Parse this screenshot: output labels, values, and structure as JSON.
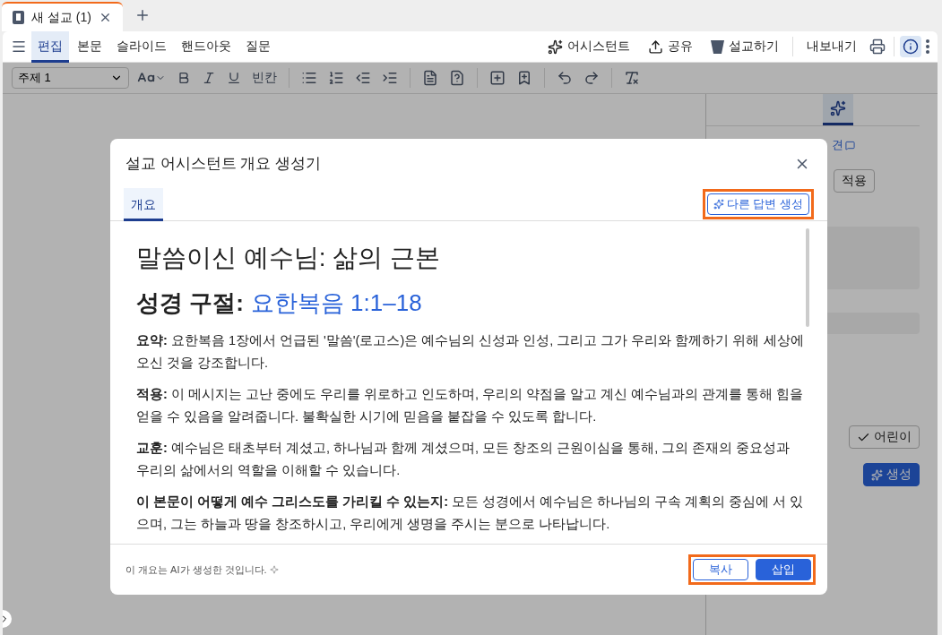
{
  "browser_tabs": [
    {
      "title": "새 설교 (1)",
      "selected": true
    }
  ],
  "menu": {
    "tabs": [
      {
        "label": "편집",
        "selected": true
      },
      {
        "label": "본문",
        "selected": false
      },
      {
        "label": "슬라이드",
        "selected": false
      },
      {
        "label": "핸드아웃",
        "selected": false
      },
      {
        "label": "질문",
        "selected": false
      }
    ],
    "actions": [
      {
        "label": "어시스턴트",
        "kind": "assistant"
      },
      {
        "label": "공유",
        "kind": "share"
      },
      {
        "label": "설교하기",
        "kind": "preach"
      },
      {
        "label": "내보내기",
        "kind": "export"
      }
    ],
    "info_selected": true
  },
  "toolbar": {
    "style_select": "주제 1",
    "blank_label": "빈칸"
  },
  "panel": {
    "link": "견",
    "apply": "적용",
    "audience": {
      "label": "어린이",
      "checked": true
    },
    "generate": "생성"
  },
  "dialog": {
    "title": "설교 어시스턴트 개요 생성기",
    "tabs": [
      {
        "label": "개요",
        "selected": true
      }
    ],
    "regenerate": "다른 답변 생성",
    "heading": "말씀이신 예수님: 삶의 근본",
    "passage_label": "성경 구절:",
    "passage": "요한복음 1:1–18",
    "paragraphs": [
      "**요약:** 요한복음 1장에서 언급된 '말씀'(로고스)은 예수님의 신성과 인성, 그리고 그가 우리와 함께하기 위해 세상에 오신 것을 강조합니다.",
      "**적용:** 이 메시지는 고난 중에도 우리를 위로하고 인도하며, 우리의 약점을 알고 계신 예수님과의 관계를 통해 힘을 얻을 수 있음을 알려줍니다. 불확실한 시기에 믿음을 붙잡을 수 있도록 합니다.",
      "**교훈:** 예수님은 태초부터 계셨고, 하나님과 함께 계셨으며, 모든 창조의 근원이심을 통해, 그의 존재의 중요성과 우리의 삶에서의 역할을 이해할 수 있습니다.",
      "**이 본문이 어떻게 예수 그리스도를 가리킬 수 있는지:** 모든 성경에서 예수님은 하나님의 구속 계획의 중심에 서 있으며, 그는 하늘과 땅을 창조하시고, 우리에게 생명을 주시는 분으로 나타납니다."
    ],
    "footnote": "이 개요는 AI가 생성한 것입니다.",
    "copy": "복사",
    "insert": "삽입"
  }
}
